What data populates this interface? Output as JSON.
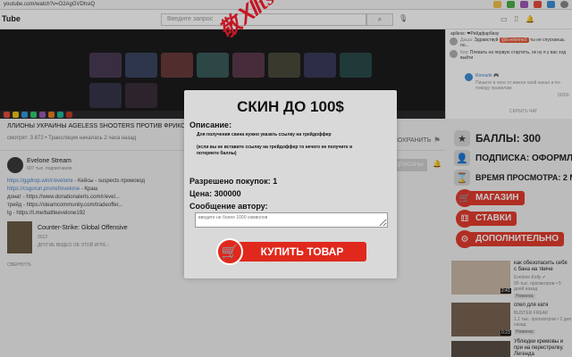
{
  "browser": {
    "url": "youtube.com/watch?v=O2AgGVDhsiQ"
  },
  "header": {
    "logo": "Tube",
    "search_placeholder": "Введите запрос",
    "search_icon": "search-icon",
    "mic_icon": "mic-icon"
  },
  "video": {
    "title": "ЛЛИОНЫ УКРАИНЫ AGELESS SHOOTERS ПРОТИВ ФРИКОВ",
    "views": "смотрят: 3 872 • Трансляция началась 2 часа назад",
    "save_label": "СОХРАНИТЬ"
  },
  "channel": {
    "name": "Evelone Stream",
    "subscribers": "607 тыс. подписчиков",
    "subscribe_label": "ПОДПИСАНЫ"
  },
  "description": [
    {
      "link": "https://ggdrop.win/r/evelone",
      "text": " - Кейсы - suspects промокод"
    },
    {
      "link": "https://csgorun.pro/ref/evelone",
      "text": " - Краш"
    },
    {
      "link": "",
      "text": "донат - https://www.donationalerts.com/r/evel..."
    },
    {
      "link": "",
      "text": "трейд - https://steamcommunity.com/tradeoffer..."
    },
    {
      "link": "",
      "text": "tg - https://t.me/battleevelone192"
    }
  ],
  "game": {
    "title": "Counter-Strike: Global Offensive",
    "year": "2012",
    "more": "ДРУГИЕ ВИДЕО ОБ ЭТОЙ ИГРЕ  ›",
    "collapse": "СВЕРНУТЬ"
  },
  "chat": {
    "top_line": "apllexs: ❤Рейдфарбизу",
    "messages": [
      {
        "author": "Даша:",
        "text": "Здравствуй ",
        "badge": "@Evelonne2",
        "rest": " ты не спускаешь по..."
      },
      {
        "author": "Кик:",
        "text": "Плевать на первую стартить, ок ну я у вас ход выйти",
        "badge": "",
        "rest": ""
      }
    ],
    "input_author": "Romarik 🎮",
    "input_hint": "Пишите в чате от имени свой канал и по-поводу правилам",
    "counter": "0/200",
    "hide_chat": "СКРЫТЬ ЧАТ"
  },
  "promo": {
    "points_label": "БАЛЛЫ: 300",
    "subscription_label": "ПОДПИСКА: ОФОРМЛ",
    "watch_time_label": "ВРЕМЯ ПРОСМОТРА: 2 МИН",
    "shop_label": "МАГАЗИН",
    "bets_label": "СТАВКИ",
    "extra_label": "ДОПОЛНИТЕЛЬНО"
  },
  "related": [
    {
      "title": "как обезопасить себя с бана на твиче",
      "channel": "Evelone Kolly ✔",
      "meta": "90 тыс. просмотров • 5 дней назад",
      "badge": "Новинка",
      "time": "2:41"
    },
    {
      "title": "спел для катя",
      "channel": "BUSTER FREAK",
      "meta": "1,1 тыс. просмотров • 2 дня назад",
      "badge": "Новинка",
      "time": "0:23"
    },
    {
      "title": "Ублюдки кремовы и при на перестрелку. Легенда",
      "channel": "",
      "meta": "",
      "badge": "",
      "time": ""
    }
  ],
  "modal": {
    "title": "СКИН ДО 100$",
    "description_heading": "Описание:",
    "description_line1": "Для получения скина нужно указать ссылку на трейдоффер",
    "description_line2": "(если вы не вставите ссылку на трейдоффер то нечего не получите и потеряете баллы)",
    "purchases_label": "Разрешено покупок: 1",
    "price_label": "Цена: 300000",
    "message_label": "Сообщение автору:",
    "message_placeholder": "введите не более 1000 символов",
    "buy_label": "КУПИТЬ ТОВАР"
  },
  "colors": {
    "accent_red": "#e0291c",
    "link_blue": "#4b86c9",
    "modal_bg": "#d9d9d9"
  }
}
